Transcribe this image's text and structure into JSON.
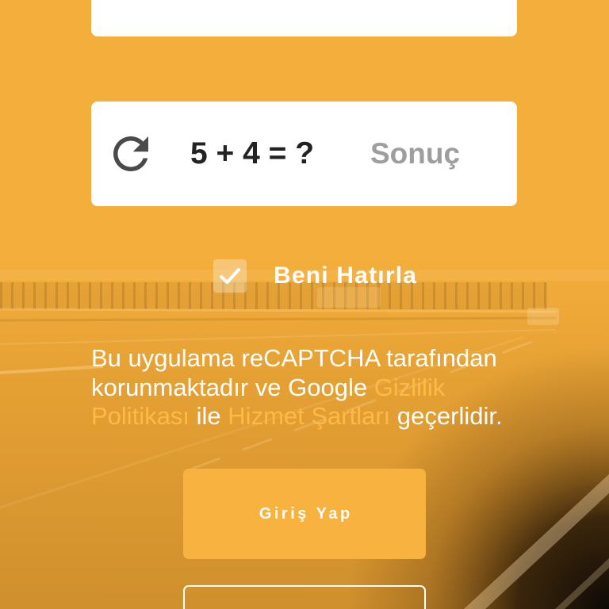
{
  "colors": {
    "background": "#F4AE3B",
    "button": "#F7B240",
    "link": "#FFBA45",
    "text_light": "#FFFFFF",
    "captcha_text": "#222222",
    "placeholder": "#9E9E9E",
    "icon": "#4A4A4A"
  },
  "captcha": {
    "refresh_icon": "refresh-icon",
    "question": "5 + 4 = ?",
    "answer_placeholder": "Sonuç"
  },
  "remember_me": {
    "checked": true,
    "check_icon": "check-icon",
    "label": "Beni Hatırla"
  },
  "recaptcha_notice": {
    "text_before": "Bu uygulama reCAPTCHA tarafından korunmaktadır ve Google ",
    "privacy_link": "Gizlilik Politikası",
    "text_middle": " ile ",
    "terms_link": "Hizmet Şartları",
    "text_after": " geçerlidir."
  },
  "login_button": {
    "label": "Giriş Yap"
  }
}
